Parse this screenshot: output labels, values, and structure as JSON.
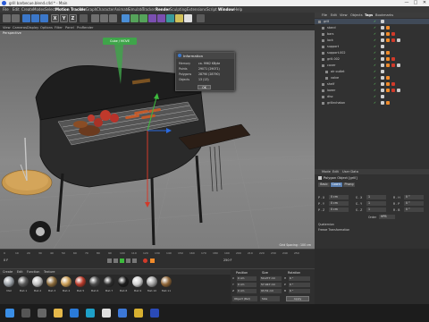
{
  "app": {
    "title": "grill barbecue.blend.c4d * - Main",
    "win_min": "—",
    "win_max": "□",
    "win_close": "✕"
  },
  "menu": [
    "File",
    "Edit",
    "Create",
    "Modes",
    "Select",
    "Motion Tracker",
    "MoGraph",
    "Character",
    "Animate",
    "Simulate",
    "Tracker",
    "Render",
    "Sculpting",
    "Extensions",
    "Script",
    "Window",
    "Help"
  ],
  "menu_highlight": [
    "Motion Tracker",
    "Render",
    "Window"
  ],
  "toolbar": {
    "x": "X",
    "y": "Y",
    "z": "Z"
  },
  "viewport_menu": [
    "View",
    "Cameras",
    "Display",
    "Options",
    "Filter",
    "Panel",
    "ProRender"
  ],
  "viewport": {
    "label": "Perspective",
    "grid_spacing": "Grid Spacing : 100 cm"
  },
  "tooltip": {
    "text": "Cube / MOVE"
  },
  "info_dialog": {
    "title": "Information",
    "rows": [
      {
        "k": "Memory",
        "v": "ca. 9962 KByte"
      },
      {
        "k": "Points",
        "v": "29071 (29071)"
      },
      {
        "k": "Polygons",
        "v": "28790 (28790)"
      },
      {
        "k": "Objects",
        "v": "13 (13)"
      }
    ],
    "ok": "OK"
  },
  "object_manager": {
    "tabs": [
      "File",
      "Edit",
      "View",
      "Objects",
      "Tags",
      "Bookmarks"
    ],
    "objects": [
      {
        "name": "grill",
        "level": 0
      },
      {
        "name": "stand",
        "level": 1
      },
      {
        "name": "bars",
        "level": 1
      },
      {
        "name": "lock",
        "level": 1
      },
      {
        "name": "support",
        "level": 1
      },
      {
        "name": "support.002",
        "level": 1
      },
      {
        "name": "grill.002",
        "level": 1
      },
      {
        "name": "cover",
        "level": 1
      },
      {
        "name": "air outlet",
        "level": 2
      },
      {
        "name": "valve",
        "level": 2
      },
      {
        "name": "shelf",
        "level": 1
      },
      {
        "name": "lower",
        "level": 1
      },
      {
        "name": "disc",
        "level": 1
      },
      {
        "name": "grillechaton",
        "level": 1
      }
    ]
  },
  "attribute_manager": {
    "tabs": [
      "Mode",
      "Edit",
      "User Data"
    ],
    "object_label": "Polygon Object [grill]",
    "subtabs": [
      "Basic",
      "Coord.",
      "Phong"
    ],
    "active_subtab": "Coord.",
    "fields": [
      {
        "k": "P . X",
        "v": "0 cm"
      },
      {
        "k": "S . X",
        "v": "1"
      },
      {
        "k": "R . H",
        "v": "0 °"
      },
      {
        "k": "P . Y",
        "v": "0 cm"
      },
      {
        "k": "S . Y",
        "v": "1"
      },
      {
        "k": "R . P",
        "v": "0 °"
      },
      {
        "k": "P . Z",
        "v": "0 cm"
      },
      {
        "k": "S . Z",
        "v": "1"
      },
      {
        "k": "R . B",
        "v": "0 °"
      }
    ],
    "order_label": "Order",
    "order_value": "HPB",
    "sections": [
      "Quaternion",
      "Freeze Transformation"
    ]
  },
  "timeline": {
    "ticks": [
      "0",
      "10",
      "20",
      "30",
      "40",
      "50",
      "60",
      "70",
      "80",
      "90",
      "100",
      "110",
      "120",
      "130",
      "140",
      "150",
      "160",
      "170",
      "180",
      "190",
      "200",
      "210",
      "220",
      "230",
      "240",
      "250"
    ],
    "frame": "0 F",
    "end": "250 F"
  },
  "materials": {
    "menu": [
      "Create",
      "Edit",
      "Function",
      "Texture"
    ],
    "items": [
      {
        "label": "Mat",
        "color": "#9aa0a6"
      },
      {
        "label": "Mat.1",
        "color": "#5a5a5a"
      },
      {
        "label": "Mat.2",
        "color": "#c0c0c0"
      },
      {
        "label": "Mat.3",
        "color": "#8a6a3a"
      },
      {
        "label": "Mat.4",
        "color": "#c89c55"
      },
      {
        "label": "Mat.5",
        "color": "#b83a2a"
      },
      {
        "label": "Mat.6",
        "color": "#4a4a4a"
      },
      {
        "label": "Mat.7",
        "color": "#2e2e2e"
      },
      {
        "label": "Mat.8",
        "color": "#1c1c1c"
      },
      {
        "label": "Mat.9",
        "color": "#d0d0d0"
      },
      {
        "label": "Mat.10",
        "color": "#a0a0a0"
      },
      {
        "label": "Mat.11",
        "color": "#8d6436"
      }
    ]
  },
  "coordinates": {
    "headers": [
      "Position",
      "Size",
      "Rotation"
    ],
    "rows": [
      {
        "axis": "X",
        "pos": "0 cm",
        "size": "54.277 cm",
        "rot": "H",
        "rotv": "0 °"
      },
      {
        "axis": "Y",
        "pos": "0 cm",
        "size": "57.047 cm",
        "rot": "P",
        "rotv": "0 °"
      },
      {
        "axis": "Z",
        "pos": "0 cm",
        "size": "93.51 cm",
        "rot": "B",
        "rotv": "0 °"
      }
    ],
    "mode": "Object (Rel)",
    "size_mode": "Size",
    "apply": "Apply"
  },
  "taskbar": {
    "search": "⌕",
    "icons": [
      {
        "name": "start-icon",
        "color": "#3a8ee6"
      },
      {
        "name": "search-icon",
        "color": "#555"
      },
      {
        "name": "task-view-icon",
        "color": "#666"
      },
      {
        "name": "folder-icon",
        "color": "#e5b84a"
      },
      {
        "name": "mail-icon",
        "color": "#2a7ad8"
      },
      {
        "name": "edge-icon",
        "color": "#1ea0c8"
      },
      {
        "name": "x-app-icon",
        "color": "#e0e0e0"
      },
      {
        "name": "photos-icon",
        "color": "#3c78d8"
      },
      {
        "name": "chrome-icon",
        "color": "#d8b030"
      },
      {
        "name": "cinema4d-icon",
        "color": "#2a4ab8"
      }
    ]
  },
  "colors": {
    "panel": "#313131",
    "accent": "#3fa54a",
    "highlight": "#f08b2b",
    "axis_red": "#d23a2a",
    "axis_green": "#3dbb3d",
    "axis_blue": "#2a6ae0"
  }
}
